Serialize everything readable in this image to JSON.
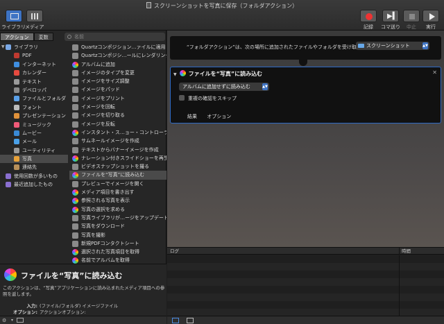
{
  "window": {
    "title": "スクリーンショットを写真に保存（フォルダアクション）"
  },
  "toolbar": {
    "library_label": "ライブラリ",
    "media_label": "メディア",
    "record_label": "記録",
    "step_label": "コマ送り",
    "stop_label": "中止",
    "run_label": "実行"
  },
  "left": {
    "tabs": [
      "アクション",
      "変数"
    ],
    "search_placeholder": "名前",
    "categories": [
      {
        "label": "ライブラリ",
        "color": "#7aa8e6",
        "sub": false
      },
      {
        "label": "PDF",
        "color": "#c03a30",
        "sub": true
      },
      {
        "label": "インターネット",
        "color": "#3f8ee0",
        "sub": true
      },
      {
        "label": "カレンダー",
        "color": "#e64a3f",
        "sub": true
      },
      {
        "label": "テキスト",
        "color": "#9a9a9a",
        "sub": true
      },
      {
        "label": "デベロッパ",
        "color": "#8a8a8a",
        "sub": true
      },
      {
        "label": "ファイルとフォルダ",
        "color": "#5aa0e8",
        "sub": true
      },
      {
        "label": "フォント",
        "color": "#bbbbbb",
        "sub": true
      },
      {
        "label": "プレゼンテーション",
        "color": "#e0913a",
        "sub": true
      },
      {
        "label": "ミュージック",
        "color": "#f05a78",
        "sub": true
      },
      {
        "label": "ムービー",
        "color": "#3a8ad6",
        "sub": true
      },
      {
        "label": "メール",
        "color": "#4aa0e8",
        "sub": true
      },
      {
        "label": "ユーティリティ",
        "color": "#9a9a9a",
        "sub": true
      },
      {
        "label": "写真",
        "color": "#e8a23a",
        "sub": true
      },
      {
        "label": "連絡先",
        "color": "#b8905a",
        "sub": true
      },
      {
        "label": "使用回数が多いもの",
        "color": "#8a6fd0",
        "sub": false
      },
      {
        "label": "最近追加したもの",
        "color": "#8a6fd0",
        "sub": false
      }
    ],
    "selected_category_index": 13,
    "actions": [
      {
        "label": "Quartzコンポジション…ァイルに適用",
        "icon": "quartz-icon"
      },
      {
        "label": "Quartzコンポジシ…ールにレンダリング",
        "icon": "quartz-icon"
      },
      {
        "label": "アルバムに追加",
        "icon": "photos-icon"
      },
      {
        "label": "イメージのタイプを変更",
        "icon": "preview-icon"
      },
      {
        "label": "イメージをサイズ調整",
        "icon": "preview-icon"
      },
      {
        "label": "イメージをパッド",
        "icon": "preview-icon"
      },
      {
        "label": "イメージをプリント",
        "icon": "preview-icon"
      },
      {
        "label": "イメージを回転",
        "icon": "preview-icon"
      },
      {
        "label": "イメージを切り取る",
        "icon": "preview-icon"
      },
      {
        "label": "イメージを反転",
        "icon": "preview-icon"
      },
      {
        "label": "インスタント・ス…ョー・コントローラ",
        "icon": "photos-icon"
      },
      {
        "label": "サムネールイメージを作成",
        "icon": "preview-icon"
      },
      {
        "label": "テキストからバナーイメージを作成",
        "icon": "preview-icon"
      },
      {
        "label": "ナレーション付きスライドショーを再生",
        "icon": "photos-icon"
      },
      {
        "label": "ビデオスナップショットを撮る",
        "icon": "preview-icon"
      },
      {
        "label": "ファイルを“写真”に読み込む",
        "icon": "photos-icon"
      },
      {
        "label": "プレビューでイメージを開く",
        "icon": "preview-icon"
      },
      {
        "label": "メディア項目を書き出す",
        "icon": "photos-icon"
      },
      {
        "label": "参照される写真を表示",
        "icon": "photos-icon"
      },
      {
        "label": "写真の選択を求める",
        "icon": "photos-icon"
      },
      {
        "label": "写真ライブラリが…ージをアップデート",
        "icon": "preview-icon"
      },
      {
        "label": "写真をダウンロード",
        "icon": "preview-icon"
      },
      {
        "label": "写真を撮影",
        "icon": "preview-icon"
      },
      {
        "label": "新規PDFコンタクトシート",
        "icon": "preview-icon"
      },
      {
        "label": "選択された写真項目を取得",
        "icon": "photos-icon"
      },
      {
        "label": "名前でアルバムを取得",
        "icon": "photos-icon"
      }
    ],
    "selected_action_index": 15,
    "description": {
      "title": "ファイルを“写真”に読み込む",
      "text": "このアクションは、“写真”アプリケーションに読み込まれたメディア項目への参照を返します。",
      "input_key": "入力:",
      "input_value": "(ファイル/フォルダ) イメージファイル",
      "option_key": "オプション:",
      "option_value": "アクションオプション:"
    }
  },
  "workflow": {
    "header_text": "“フォルダアクション”は、次の場所に追加されたファイルやフォルダを受け取る:",
    "folder_value": "スクリーンショット",
    "action": {
      "title": "ファイルを“写真”に読み込む",
      "popup_value": "アルバムに追加せずに読み込む",
      "checkbox_label": "重複の確認をスキップ",
      "tabs": [
        "結果",
        "オプション"
      ]
    }
  },
  "log": {
    "col_log": "ログ",
    "col_time": "時間"
  }
}
